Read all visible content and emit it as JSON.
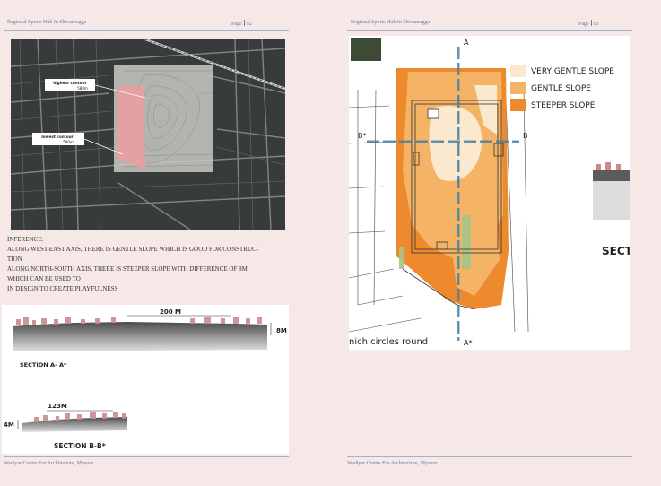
{
  "left_page": {
    "header_title": "Regional Sports Hub In Shivamogga",
    "page_label": "Page",
    "page_number": "92",
    "footer": "Wadiyar Centre For Architecture, Mysuru.",
    "map": {
      "highest_contour_label": "highest contour",
      "highest_contour_value": "588m",
      "lowest_contour_label": "lowest contour",
      "lowest_contour_value": "580m"
    },
    "inference": {
      "title": "INFERENCE:",
      "line1": "ALONG WEST-EAST AXIS, THERE IS GENTLE SLOPE  WHICH IS GOOD FOR CONSTRUC-",
      "line2": "TION",
      "line3": "ALONG NORTH-SOUTH AXIS, THERE IS STEEPER SLOPE WITH DIFFERENCE OF 8M",
      "line4": "WHICH CAN BE USED TO",
      "line5": "IN DESIGN  TO CREATE PLAYFULNESS"
    },
    "section_aa": {
      "width_label": "200 M",
      "height_label": "8M",
      "title": "SECTION  A- A*"
    },
    "section_bb": {
      "width_label": "123M",
      "height_label": "4M",
      "title": "SECTION B-B*"
    }
  },
  "right_page": {
    "header_title": "Regional Sports Hub In Shivamogga",
    "page_label": "Page",
    "page_number": "93",
    "footer": "Wadiyar Centre For Architecture, Mysuru.",
    "legend": [
      {
        "label": "VERY GENTLE SLOPE",
        "color": "#fbe9cf"
      },
      {
        "label": "GENTLE SLOPE",
        "color": "#f5b465"
      },
      {
        "label": "STEEPER SLOPE",
        "color": "#ed8a2e"
      }
    ],
    "axis_labels": {
      "a": "A",
      "a_star": "A*",
      "b": "B",
      "b_star": "B*"
    },
    "caption_fragment": "nich circles round",
    "section_fragment": "SECT"
  },
  "colors": {
    "header_text": "#6b7b95",
    "rule": "#9fb3cf",
    "axis_line": "#4a7fa0",
    "site_pink": "#e8a0a0"
  }
}
